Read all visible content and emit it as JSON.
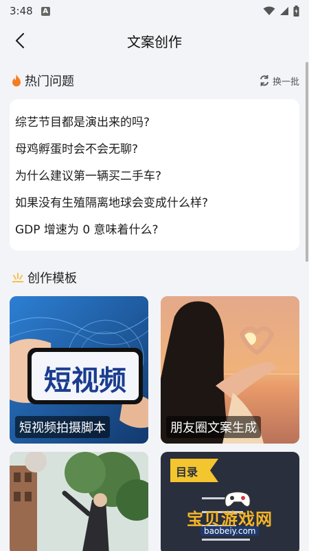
{
  "status": {
    "time": "3:48",
    "notif": "A"
  },
  "nav": {
    "title": "文案创作"
  },
  "hot": {
    "title": "热门问题",
    "refresh_label": "换一批",
    "questions": [
      "综艺节目都是演出来的吗?",
      "母鸡孵蛋时会不会无聊?",
      "为什么建议第一辆买二手车?",
      "如果没有生殖隔离地球会变成什么样?",
      "GDP 增速为 0 意味着什么?"
    ]
  },
  "templates": {
    "title": "创作模板",
    "items": [
      {
        "label": "短视频拍摄脚本",
        "art_text": "短视频"
      },
      {
        "label": "朋友圈文案生成"
      },
      {
        "label": ""
      },
      {
        "label": "",
        "art_text": "目录"
      }
    ]
  },
  "watermark": {
    "main": "宝贝游戏网",
    "sub": "baobeiy.com"
  },
  "colors": {
    "accent": "#f57c1f",
    "bg": "#f3f4f8",
    "card": "#ffffff"
  }
}
